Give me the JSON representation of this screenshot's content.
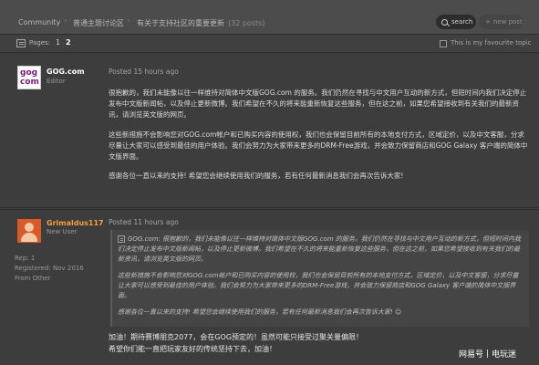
{
  "breadcrumb": {
    "items": [
      {
        "label": "Community"
      },
      {
        "label": "普通主题讨论区"
      },
      {
        "label": "有关于支持社区的重要更新",
        "count": "(32 posts)"
      }
    ]
  },
  "toolbar": {
    "search_label": "search",
    "new_post_label": "new post"
  },
  "pagination": {
    "label": "Pages:",
    "pages": [
      "1",
      "2"
    ],
    "current": "2"
  },
  "favourite": {
    "label": "This is my favourite topic",
    "checked": false
  },
  "posts": [
    {
      "username": "GOG.com",
      "role": "Editor",
      "avatar_text": [
        "gog",
        "com"
      ],
      "posted": "Posted 15 hours ago",
      "paragraphs": [
        "很抱歉的，我们未能像以往一样维持对简体中文版GOG.com 的服务。我们仍然在寻找与中文用户互动的新方式，但短时间内我们决定停止发布中文版新闻帖，以及停止更新微博。我们希望在不久的将来能重新恢复这些服务，但在这之前，如果您希望接收到有关我们的最新资讯，请浏览英文版的网页。",
        "这些新措施不会影响您对GOG.com帐户和已购买内容的使用权，我们也会保留目前所有的本地支付方式，区域定价，以及中文客服，分求尽量让大家可以感受到最佳的用户体验。我们会努力为大家带来更多的DRM-Free游戏，并会致力保留商店和GOG Galaxy 客户端的简体中文版界面。",
        "感谢各位一直以来的支持! 希望您会继续使用我们的服务，若有任何最新消息我们会再次告诉大家!"
      ]
    },
    {
      "username": "Grimaldus117",
      "role": "New User",
      "rep": "Rep: 1",
      "registered": "Registered: Nov 2016",
      "from": "From Other",
      "posted": "Posted 11 hours ago",
      "quote": [
        "GOG.com: 很抱歉的，我们未能像以往一样维持对简体中文版GOG.com 的服务。我们仍然在寻找与中文用户互动的新方式，但短时间内我们决定停止发布中文版新闻帖，以及停止更新微博。我们希望在不久的将来能重新恢复这些服务，但在这之前，如果您希望接收到有关我们的最新资讯，请浏览英文版的网页。",
        "这些新措施不会影响您对GOG.com帐户和已购买内容的使用权，我们也会保留目前所有的本地支付方式，区域定价，以及中文客服，分求尽量让大家可以感受到最佳的用户体验。我们会努力为大家带来更多的DRM-Free游戏，并会致力保留商店和GOG Galaxy 客户端的简体中文版界面。",
        "感谢各位一直以来的支持! 希望您会继续使用我们的服务，若有任何最新消息我们会再次告诉大家! ☺"
      ],
      "reply_lines": [
        "加油！期待赛博朋克2077，会在GOG预定的！虽然可能只接受过聚关量偏限！",
        "希望你们能一直把玩家友好的传统坚持下去，加油！"
      ]
    }
  ],
  "watermark": {
    "left": "网易号",
    "right": "电玩迷"
  }
}
